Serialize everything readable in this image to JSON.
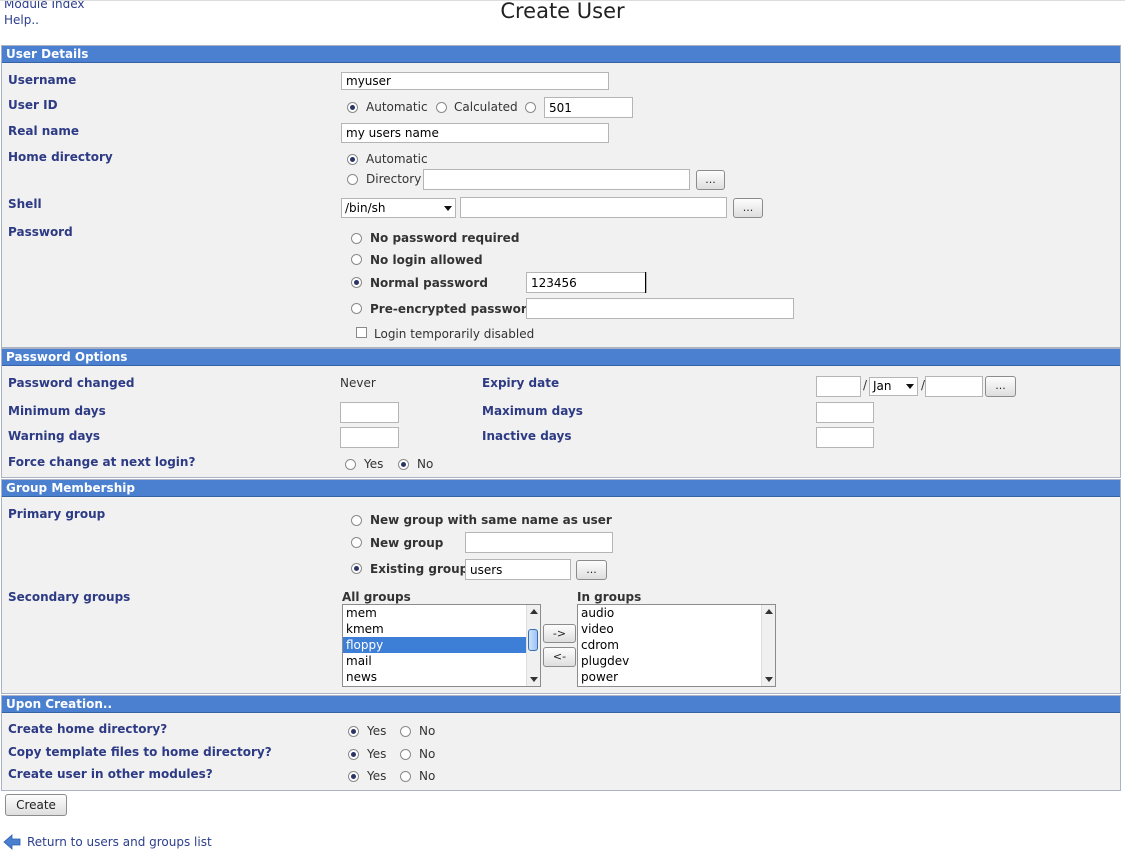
{
  "nav": {
    "module_index": "Module Index",
    "help": "Help.."
  },
  "page_title": "Create User",
  "user_details": {
    "header": "User Details",
    "username_label": "Username",
    "username_value": "myuser",
    "userid_label": "User ID",
    "userid_automatic": "Automatic",
    "userid_calculated": "Calculated",
    "userid_value": "501",
    "realname_label": "Real name",
    "realname_value": "my users name",
    "homedir_label": "Home directory",
    "homedir_automatic": "Automatic",
    "homedir_directory": "Directory",
    "browse": "...",
    "shell_label": "Shell",
    "shell_selected": "/bin/sh",
    "password_label": "Password",
    "pw_none": "No password required",
    "pw_nologin": "No login allowed",
    "pw_normal": "Normal password",
    "pw_normal_value": "123456",
    "pw_preenc": "Pre-encrypted password",
    "login_disabled": "Login temporarily disabled"
  },
  "password_options": {
    "header": "Password Options",
    "changed_label": "Password changed",
    "changed_value": "Never",
    "expiry_label": "Expiry date",
    "expiry_month": "Jan",
    "slash": "/",
    "min_label": "Minimum days",
    "max_label": "Maximum days",
    "warn_label": "Warning days",
    "inactive_label": "Inactive days",
    "force_label": "Force change at next login?",
    "yes": "Yes",
    "no": "No"
  },
  "group_membership": {
    "header": "Group Membership",
    "primary_label": "Primary group",
    "new_same": "New group with same name as user",
    "new_group": "New group",
    "existing_group": "Existing group",
    "existing_value": "users",
    "secondary_label": "Secondary groups",
    "all_groups_label": "All groups",
    "in_groups_label": "In groups",
    "all_groups": [
      "mem",
      "kmem",
      "floppy",
      "mail",
      "news"
    ],
    "in_groups": [
      "audio",
      "video",
      "cdrom",
      "plugdev",
      "power"
    ],
    "add_button": "->",
    "remove_button": "<-"
  },
  "upon_creation": {
    "header": "Upon Creation..",
    "create_home_label": "Create home directory?",
    "copy_template_label": "Copy template files to home directory?",
    "other_modules_label": "Create user in other modules?",
    "yes": "Yes",
    "no": "No"
  },
  "create_button": "Create",
  "return_link": "Return to users and groups list"
}
